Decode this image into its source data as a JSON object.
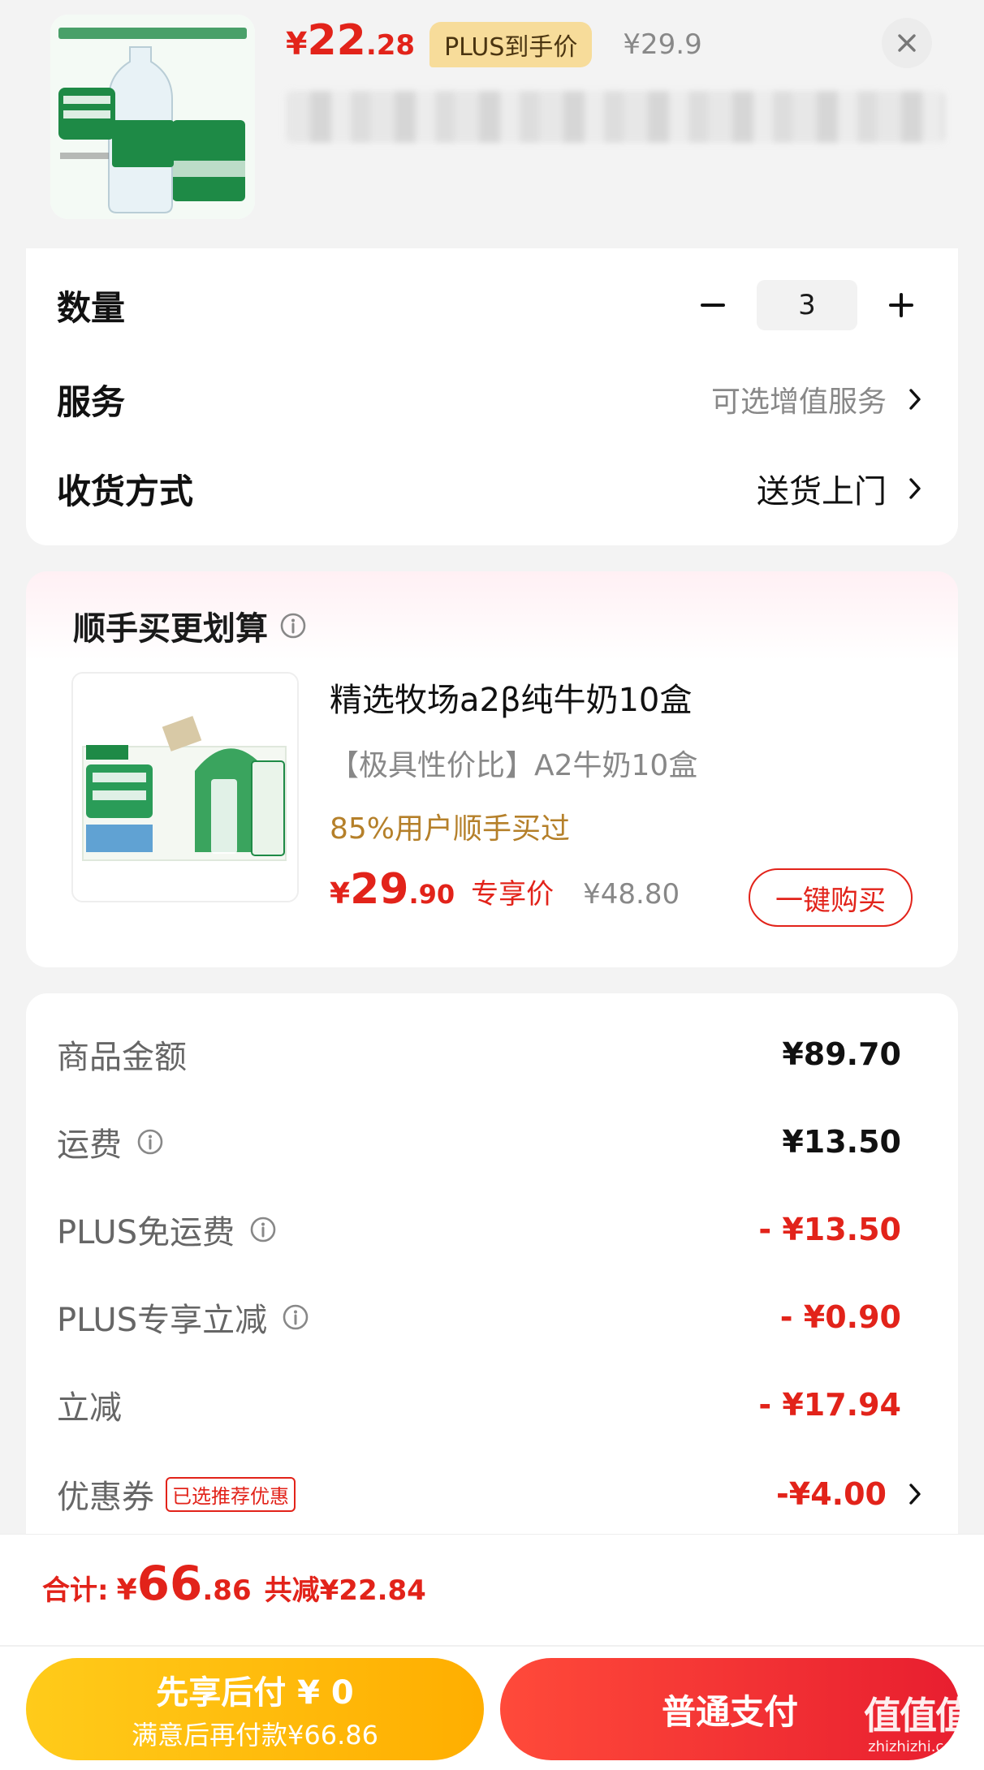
{
  "header": {
    "price_yen": "¥",
    "price_int": "22",
    "price_dec": ".28",
    "plus_badge": "PLUS到手价",
    "original_price": "¥29.9"
  },
  "options": {
    "quantity_label": "数量",
    "quantity_value": "3",
    "service_label": "服务",
    "service_value": "可选增值服务",
    "delivery_label": "收货方式",
    "delivery_value": "送货上门"
  },
  "addon": {
    "title": "顺手买更划算",
    "product_name": "精选牧场a2β纯牛奶10盒",
    "product_desc": "【极具性价比】A2牛奶10盒",
    "social_proof": "85%用户顺手买过",
    "price_yen": "¥",
    "price_int": "29",
    "price_dec": ".90",
    "price_tag": "专享价",
    "original_price": "¥48.80",
    "buy_button": "一键购买"
  },
  "summary": {
    "rows": [
      {
        "label": "商品金额",
        "value": "¥89.70",
        "info": false,
        "red": false
      },
      {
        "label": "运费",
        "value": "¥13.50",
        "info": true,
        "red": false
      },
      {
        "label": "PLUS免运费",
        "value": "- ¥13.50",
        "info": true,
        "red": true
      },
      {
        "label": "PLUS专享立减",
        "value": "- ¥0.90",
        "info": true,
        "red": true
      },
      {
        "label": "立减",
        "value": "- ¥17.94",
        "info": false,
        "red": true
      }
    ],
    "coupon_label": "优惠券",
    "coupon_tag": "已选推荐优惠",
    "coupon_value": "-¥4.00"
  },
  "footer": {
    "total_label": "合计:",
    "total_yen": "¥",
    "total_int": "66",
    "total_dec": ".86",
    "total_saved": "共减¥22.84",
    "pay_later_main": "先享后付 ¥ 0",
    "pay_later_sub": "满意后再付款¥66.86",
    "pay_normal": "普通支付"
  },
  "watermark": {
    "big": "值值值",
    "small": "zhizhizhi.com"
  },
  "colors": {
    "accent_red": "#e2231a",
    "gold": "#b5802a",
    "plus_badge_bg": "#f7dc9a",
    "pay_later_yellow": "#ffb800"
  }
}
